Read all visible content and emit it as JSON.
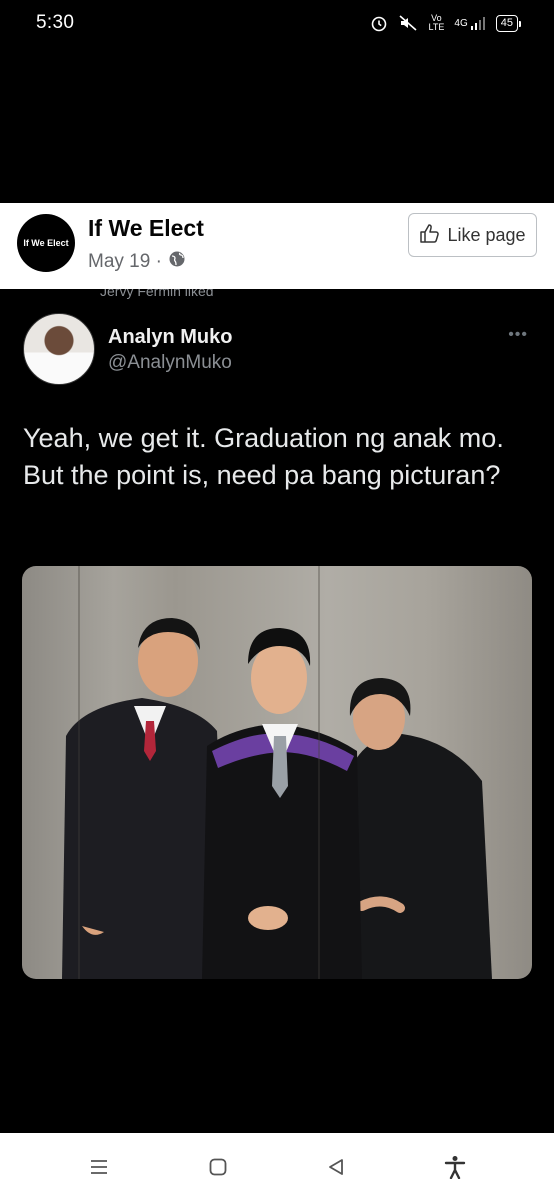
{
  "status_bar": {
    "time": "5:30",
    "network": "4G",
    "volte": "Vo LTE",
    "battery": "45"
  },
  "page_header": {
    "avatar_text": "If We Elect",
    "page_name": "If We Elect",
    "date": "May 19 ·",
    "like_button_label": "Like page"
  },
  "liked_strip": "Jervy Fermin liked",
  "tweet": {
    "display_name": "Analyn Muko",
    "handle": "@AnalynMuko",
    "text": "Yeah, we get it. Graduation ng anak mo. But the point is, need pa bang picturan?"
  },
  "colors": {
    "background": "#000000",
    "header_bg": "#ffffff",
    "handle_gray": "#8b8f94",
    "gown_purple": "#6a3fa0"
  },
  "icons": {
    "alarm": "alarm-icon",
    "mute": "mute-icon",
    "globe": "globe-icon",
    "thumbs_up": "thumbs-up-icon",
    "more": "more-icon",
    "menu": "menu-icon",
    "home": "home-icon",
    "back": "back-icon",
    "accessibility": "accessibility-icon"
  }
}
